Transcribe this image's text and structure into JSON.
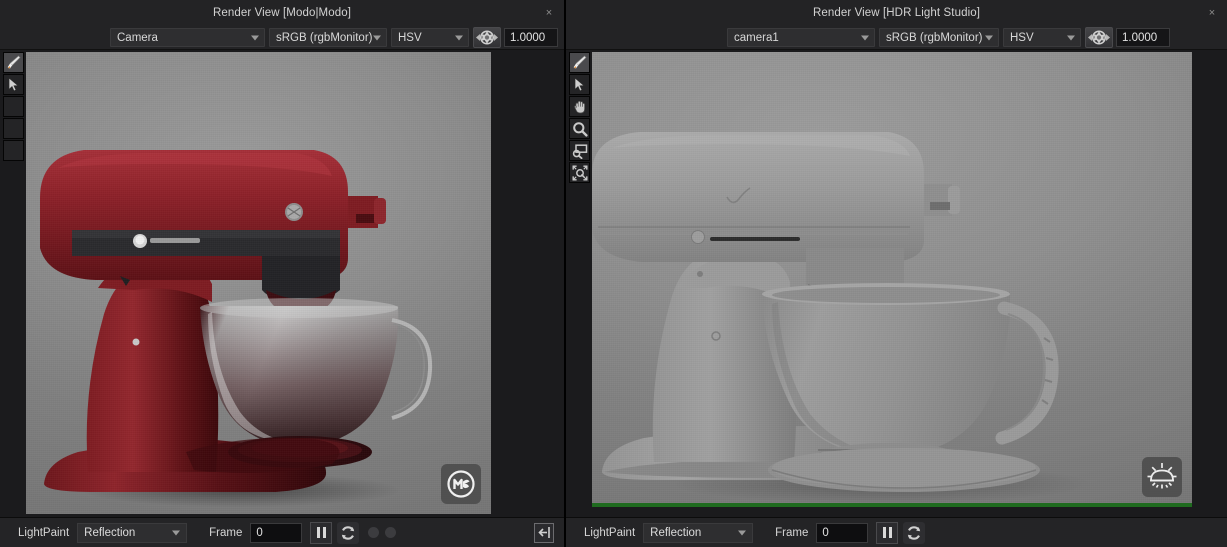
{
  "panels": [
    {
      "id": "modo",
      "title": "Render View [Modo|Modo]",
      "close_label": "×",
      "toolbar": {
        "camera": "Camera",
        "colorspace": "sRGB (rgbMonitor)",
        "channel": "HSV",
        "exposure_icon": "aperture-icon",
        "exposure_value": "1.0000"
      },
      "tools": [
        {
          "name": "brush-tool",
          "icon": "brush-icon",
          "active": true
        },
        {
          "name": "select-tool",
          "icon": "arrow-cursor-icon",
          "active": false
        },
        {
          "name": "tool-slot-3",
          "icon": "empty-icon",
          "active": false
        },
        {
          "name": "tool-slot-4",
          "icon": "empty-icon",
          "active": false
        },
        {
          "name": "tool-slot-5",
          "icon": "empty-icon",
          "active": false
        }
      ],
      "render": {
        "subject": "stand-mixer-red-render",
        "watermark_icon": "modo-logo-icon",
        "progress_visible": false,
        "progress_percent": 0
      },
      "status": {
        "lightpaint_label": "LightPaint",
        "mode": "Reflection",
        "frame_label": "Frame",
        "frame_value": "0",
        "pause_icon": "pause-icon",
        "refresh_icon": "refresh-icon",
        "indicator_dots": 2,
        "collapse_icon": "collapse-left-icon"
      }
    },
    {
      "id": "hdrls",
      "title": "Render View [HDR Light Studio]",
      "close_label": "×",
      "toolbar": {
        "camera": "camera1",
        "colorspace": "sRGB (rgbMonitor)",
        "channel": "HSV",
        "exposure_icon": "aperture-icon",
        "exposure_value": "1.0000"
      },
      "tools": [
        {
          "name": "brush-tool",
          "icon": "brush-icon",
          "active": true
        },
        {
          "name": "select-tool",
          "icon": "arrow-cursor-icon",
          "active": false
        },
        {
          "name": "pan-tool",
          "icon": "hand-icon",
          "active": false
        },
        {
          "name": "zoom-tool",
          "icon": "magnifier-icon",
          "active": false
        },
        {
          "name": "region-zoom-tool",
          "icon": "region-zoom-icon",
          "active": false
        },
        {
          "name": "fit-zoom-tool",
          "icon": "fit-zoom-icon",
          "active": false
        }
      ],
      "render": {
        "subject": "stand-mixer-grayscale-render",
        "watermark_icon": "hdr-light-studio-sun-icon",
        "progress_visible": true,
        "progress_percent": 100
      },
      "status": {
        "lightpaint_label": "LightPaint",
        "mode": "Reflection",
        "frame_label": "Frame",
        "frame_value": "0",
        "pause_icon": "pause-icon",
        "refresh_icon": "refresh-icon",
        "indicator_dots": 0,
        "collapse_icon": ""
      }
    }
  ],
  "colors": {
    "panel_bg": "#1b1b1d",
    "bar_bg": "#232325",
    "text": "#d6d6d6",
    "progress_green": "#1f6b1f",
    "mixer_red": "#8c2028"
  }
}
